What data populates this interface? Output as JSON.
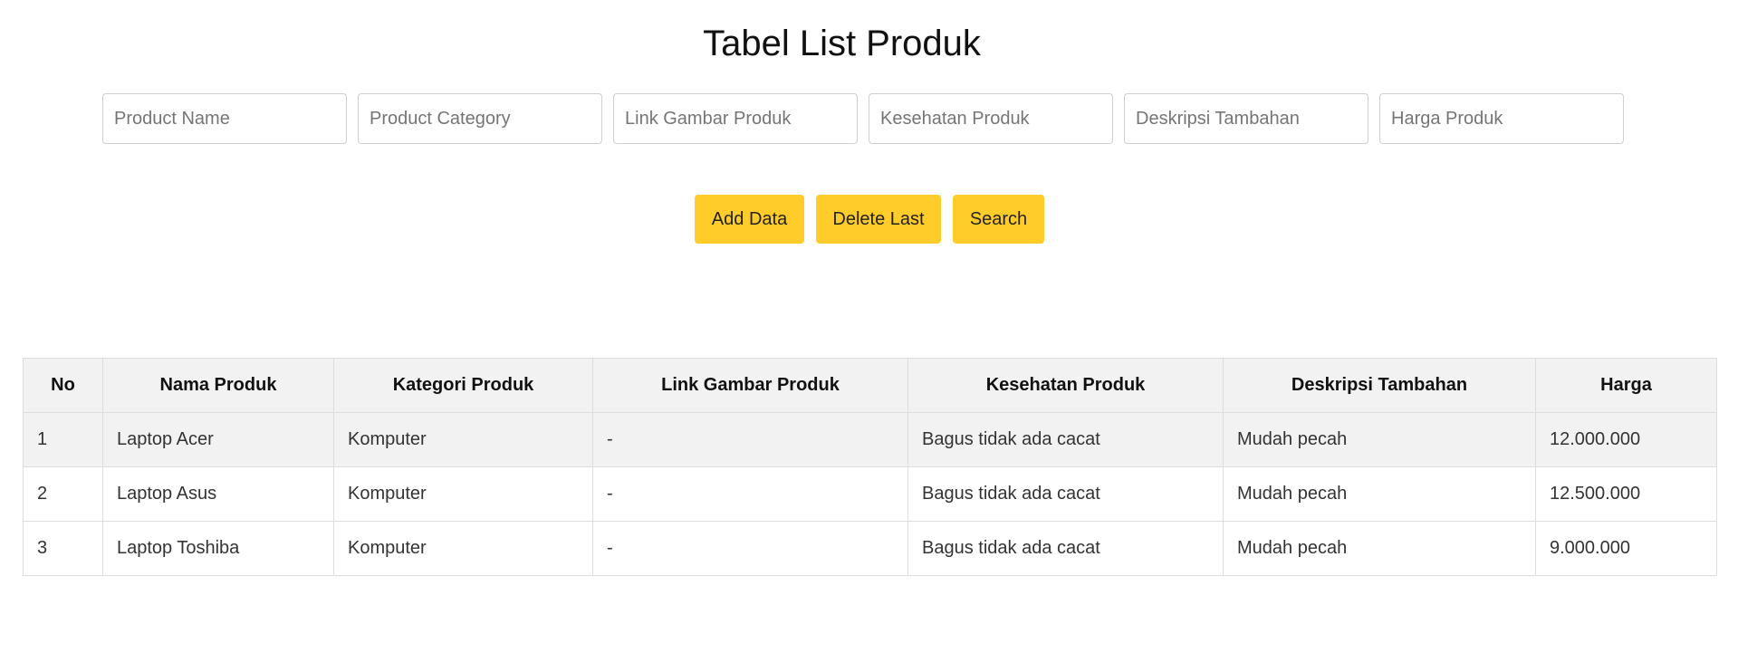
{
  "page": {
    "title": "Tabel List Produk"
  },
  "form": {
    "inputs": [
      {
        "name": "product-name-input",
        "placeholder": "Product Name",
        "value": ""
      },
      {
        "name": "product-category-input",
        "placeholder": "Product Category",
        "value": ""
      },
      {
        "name": "link-gambar-input",
        "placeholder": "Link Gambar Produk",
        "value": ""
      },
      {
        "name": "kesehatan-produk-input",
        "placeholder": "Kesehatan Produk",
        "value": ""
      },
      {
        "name": "deskripsi-tambahan-input",
        "placeholder": "Deskripsi Tambahan",
        "value": ""
      },
      {
        "name": "harga-produk-input",
        "placeholder": "Harga Produk",
        "value": ""
      }
    ],
    "buttons": {
      "add_label": "Add Data",
      "delete_label": "Delete Last",
      "search_label": "Search"
    },
    "accent_color": "#ffcc29"
  },
  "table": {
    "headers": [
      "No",
      "Nama Produk",
      "Kategori Produk",
      "Link Gambar Produk",
      "Kesehatan Produk",
      "Deskripsi Tambahan",
      "Harga"
    ],
    "rows": [
      [
        "1",
        "Laptop Acer",
        "Komputer",
        "-",
        "Bagus tidak ada cacat",
        "Mudah pecah",
        "12.000.000"
      ],
      [
        "2",
        "Laptop Asus",
        "Komputer",
        "-",
        "Bagus tidak ada cacat",
        "Mudah pecah",
        "12.500.000"
      ],
      [
        "3",
        "Laptop Toshiba",
        "Komputer",
        "-",
        "Bagus tidak ada cacat",
        "Mudah pecah",
        "9.000.000"
      ]
    ]
  }
}
